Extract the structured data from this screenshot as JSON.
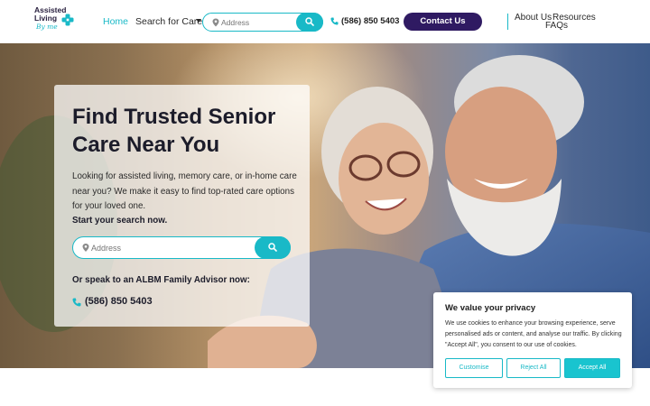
{
  "header": {
    "logo": {
      "line1": "Assisted",
      "line2": "Living",
      "line3": "By me"
    },
    "nav": {
      "home": "Home",
      "search_for_care": "Search for Care"
    },
    "search": {
      "placeholder": "Address"
    },
    "phone": "(586) 850 5403",
    "contact_label": "Contact Us",
    "about": "About Us",
    "resources": "Resources",
    "faqs": "FAQs"
  },
  "hero": {
    "title": "Find Trusted Senior Care Near You",
    "description": "Looking for assisted living, memory care, or in-home care near you? We make it easy to find top-rated care options for your loved one.",
    "start_label": "Start your search now.",
    "search_placeholder": "Address",
    "speak_label": "Or speak to an ALBM Family Advisor now:",
    "phone": "(586) 850 5403"
  },
  "cookie": {
    "title": "We value your privacy",
    "text": "We use cookies to enhance your browsing experience, serve personalised ads or content, and analyse our traffic. By clicking \"Accept All\", you consent to our use of cookies.",
    "customise": "Customise",
    "reject": "Reject All",
    "accept": "Accept All"
  },
  "colors": {
    "accent": "#19b9c7",
    "primary_dark": "#2f1a62"
  },
  "icons": {
    "pin": "map-pin-icon",
    "search": "search-icon",
    "phone": "phone-icon"
  }
}
